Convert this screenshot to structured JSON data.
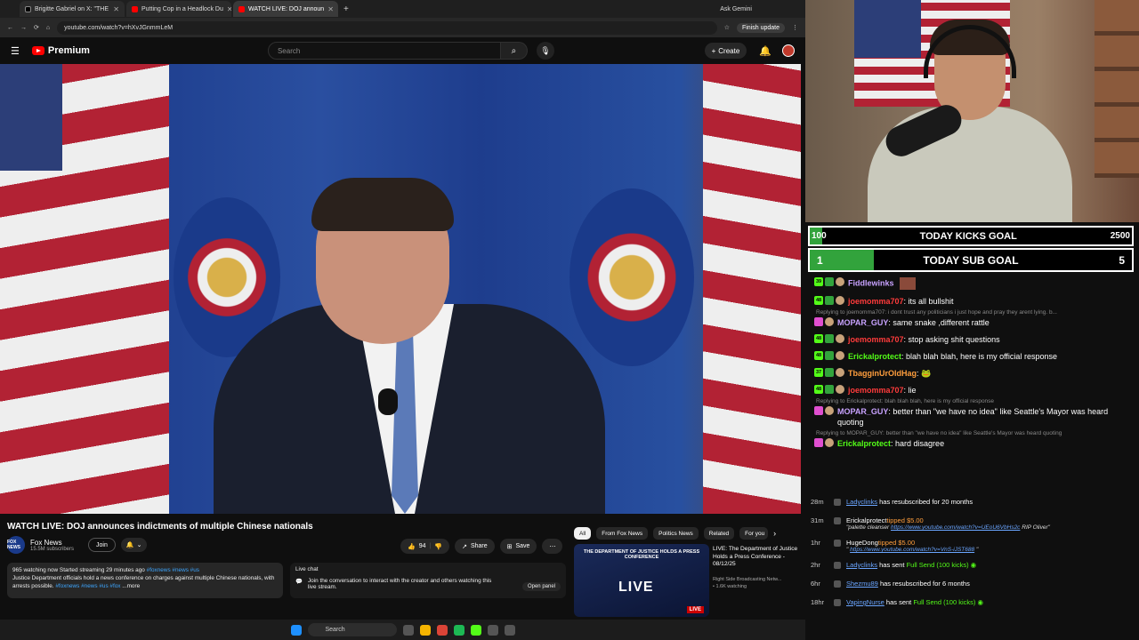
{
  "browser": {
    "tabs": [
      {
        "label": "Brigitte Gabriel on X: \"THE"
      },
      {
        "label": "Putting Cop in a Headlock Du"
      },
      {
        "label": "WATCH LIVE: DOJ announ"
      }
    ],
    "url": "youtube.com/watch?v=hXvJGnmmLeM",
    "ask_gemini": "Ask Gemini",
    "finish_update": "Finish update"
  },
  "youtube": {
    "logo_text": "Premium",
    "search_placeholder": "Search",
    "create_label": "Create",
    "video_title": "WATCH LIVE: DOJ announces indictments of multiple Chinese nationals",
    "channel_name": "Fox News",
    "channel_subs": "15.5M subscribers",
    "channel_logo": "FOX NEWS",
    "join_label": "Join",
    "likes": "94",
    "share_label": "Share",
    "save_label": "Save",
    "desc_line1": "965 watching now  Started streaming 29 minutes ago",
    "desc_tags1": "#foxnews #news #us",
    "desc_line2": "Justice Department officials hold a news conference on charges against multiple Chinese nationals, with arrests possible.",
    "desc_tags2": "#foxnews #news #us #fox",
    "desc_more": "...more",
    "livechat_title": "Live chat",
    "livechat_text": "Join the conversation to interact with the creator and others watching this live stream.",
    "open_panel": "Open panel",
    "chips": [
      "All",
      "From Fox News",
      "Politics News",
      "Related",
      "For you"
    ],
    "rec_headline": "THE DEPARTMENT OF JUSTICE HOLDS A PRESS CONFERENCE",
    "rec_live": "LIVE",
    "rec_title": "LIVE: The Department of Justice Holds a Press Conference - 08/12/25",
    "rec_channel": "Right Side Broadcasting Netw...",
    "rec_watching": "1.6K watching",
    "rec_live_badge": "LIVE"
  },
  "taskbar": {
    "search_label": "Search"
  },
  "goals": {
    "kicks": {
      "current": "100",
      "label": "TODAY KICKS GOAL",
      "target": "2500",
      "progress": 0.04
    },
    "subs": {
      "current": "1",
      "label": "TODAY SUB GOAL",
      "target": "5",
      "progress": 0.2
    }
  },
  "chat": [
    {
      "user": "Fiddlewinks",
      "color": "#c8a2ff",
      "text": "",
      "level": "39"
    },
    {
      "user": "joemomma707",
      "color": "#ff3b3b",
      "text": ": its all bullshit",
      "level": "48"
    },
    {
      "reply": "Replying to joemomma707: i dont trust any politicians i just hope and pray they arent lying. b..."
    },
    {
      "user": "MOPAR_GUY",
      "color": "#c8a2ff",
      "text": ": same snake ,different rattle",
      "level": ""
    },
    {
      "user": "joemomma707",
      "color": "#ff3b3b",
      "text": ": stop asking shit questions",
      "level": "48"
    },
    {
      "user": "Erickalprotect",
      "color": "#53fc18",
      "text": ": blah blah blah, here is my official response",
      "level": "48"
    },
    {
      "user": "TbagginUrOldHag",
      "color": "#ff9e3d",
      "text": ":",
      "level": "37"
    },
    {
      "user": "joemomma707",
      "color": "#ff3b3b",
      "text": ": lie",
      "level": "48"
    },
    {
      "reply": "Replying to Erickalprotect: blah blah blah, here is my official response"
    },
    {
      "user": "MOPAR_GUY",
      "color": "#c8a2ff",
      "text": ": better than \"we have no idea\" like Seattle's Mayor was heard quoting",
      "level": ""
    },
    {
      "reply": "Replying to MOPAR_GUY: better than \"we have no idea\" like Seattle's Mayor was heard quoting"
    },
    {
      "user": "Erickalprotect",
      "color": "#53fc18",
      "text": ": hard disagree",
      "level": ""
    }
  ],
  "events": [
    {
      "time": "28m",
      "user": "Ladyclinks",
      "text": " has resubscribed for 20 months"
    },
    {
      "time": "31m",
      "user": "Erickalprotect",
      "tip": "tipped $5.00",
      "note": "\"palette cleanser",
      "link": "https://www.youtube.com/watch?v=UEoU6VbHs2c",
      "note2": "RIP Oliver\""
    },
    {
      "time": "1hr",
      "user": "HugeDong",
      "tip": "tipped $5.00",
      "note": "\"",
      "link": "https://www.youtube.com/watch?v=VnS-iJST688",
      "note2": "\""
    },
    {
      "time": "2hr",
      "user": "Ladyclinks",
      "text": " has sent ",
      "gift": "Full Send (100 kicks)"
    },
    {
      "time": "6hr",
      "user": "Shezmu89",
      "text": " has resubscribed for 6 months"
    },
    {
      "time": "18hr",
      "user": "VapingNurse",
      "text": " has sent ",
      "gift": "Full Send (100 kicks)"
    }
  ],
  "colors": {
    "youtube_red": "#ff0000",
    "kick_green": "#53fc18",
    "goal_fill": "#32a33c"
  }
}
